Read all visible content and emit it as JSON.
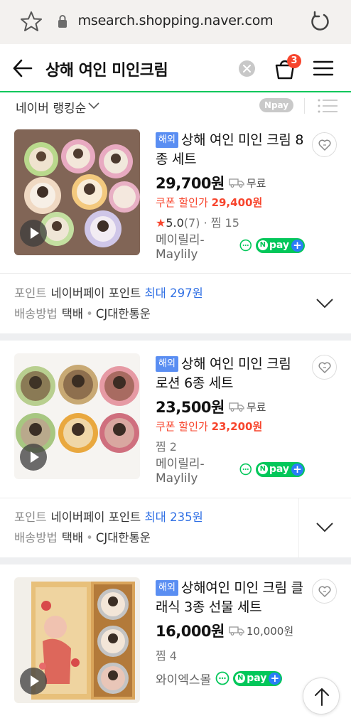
{
  "browser": {
    "url": "msearch.shopping.naver.com"
  },
  "header": {
    "query": "상해 여인 미인크림",
    "cart_count": "3"
  },
  "sortbar": {
    "sort_label": "네이버 랭킹순",
    "npay_filter": "Npay"
  },
  "products": [
    {
      "tag": "해외",
      "title": "상해 여인 미인 크림 8종 세트",
      "price": "29,700원",
      "shipping": "무료",
      "coupon_label": "쿠폰 할인가",
      "coupon_price": "29,400원",
      "rating_star": "★",
      "rating": "5.0",
      "reviews": "(7)",
      "sep": "·",
      "zzim": "찜 15",
      "mall": "메이릴리-Maylily",
      "npay": "pay",
      "benefit": {
        "point_label": "포인트",
        "point_text": "네이버페이 포인트",
        "point_max": "최대 297원",
        "ship_label": "배송방법",
        "ship_method": "택배",
        "dot": "•",
        "carrier": "CJ대한통운"
      }
    },
    {
      "tag": "해외",
      "title": "상해 여인 미인 크림 로션 6종 세트",
      "price": "23,500원",
      "shipping": "무료",
      "coupon_label": "쿠폰 할인가",
      "coupon_price": "23,200원",
      "zzim": "찜 2",
      "mall": "메이릴리-Maylily",
      "npay": "pay",
      "benefit": {
        "point_label": "포인트",
        "point_text": "네이버페이 포인트",
        "point_max": "최대 235원",
        "ship_label": "배송방법",
        "ship_method": "택배",
        "dot": "•",
        "carrier": "CJ대한통운"
      }
    },
    {
      "tag": "해외",
      "title": "상해여인 미인 크림 클래식 3종 선물 세트",
      "price": "16,000원",
      "shipping": "10,000원",
      "zzim": "찜 4",
      "mall": "와이엑스몰",
      "npay": "pay"
    }
  ],
  "colors": {
    "naver_green": "#03c75a",
    "accent_red": "#f7452d",
    "tag_blue": "#5a8ef2",
    "link_blue": "#2f6fe4"
  },
  "icons": [
    "star-icon",
    "lock-icon",
    "reload-icon",
    "back-arrow-icon",
    "clear-icon",
    "cart-icon",
    "menu-icon",
    "chevron-down-icon",
    "list-view-icon",
    "heart-icon",
    "truck-icon",
    "talk-icon",
    "play-icon",
    "arrow-up-icon"
  ]
}
